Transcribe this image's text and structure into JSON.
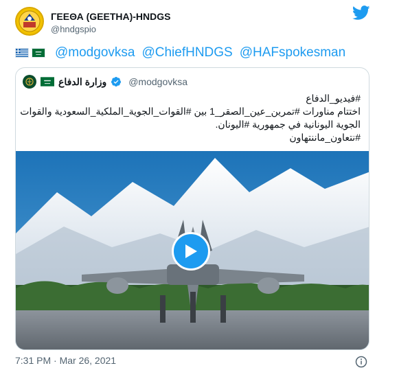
{
  "author": {
    "display_name": "ΓΕΕΘΑ (GEETHA)-HNDGS",
    "handle": "@hndgspio"
  },
  "tweet": {
    "flags": [
      "greece-flag-icon",
      "saudi-flag-icon"
    ],
    "mentions": [
      "@modgovksa",
      "@ChiefHNDGS",
      "@HAFspokesman"
    ]
  },
  "quoted": {
    "display_name": "وزارة الدفاع",
    "handle": "@modgovksa",
    "lines": [
      "#فيديو_الدفاع",
      "اختتام مناورات #تمرين_عين_الصقر_1 بين #القوات_الجوية_الملكية_السعودية والقوات",
      "الجوية اليونانية في جمهورية #اليونان.",
      "#نتعاون_ماننتهاون"
    ]
  },
  "footer": {
    "timestamp": "7:31 PM · Mar 26, 2021"
  },
  "colors": {
    "accent": "#1d9bf0",
    "text": "#0f1419",
    "secondary": "#536471"
  }
}
